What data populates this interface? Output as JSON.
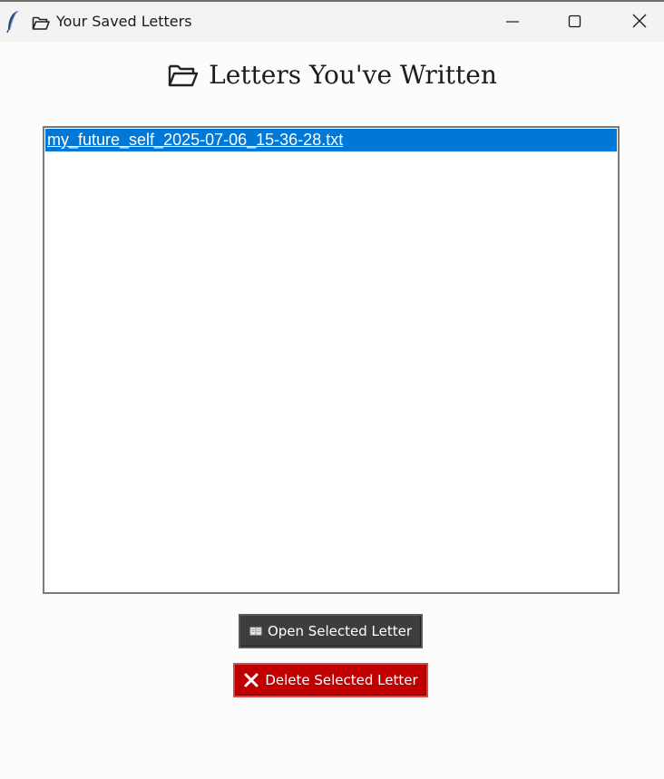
{
  "window": {
    "title": "Your Saved Letters",
    "app_icon": "feather-icon",
    "title_icon": "folder-icon",
    "controls": {
      "minimize": "minimize-icon",
      "maximize": "maximize-icon",
      "close": "close-icon"
    }
  },
  "heading": {
    "icon": "folder-icon",
    "text": "Letters You've Written"
  },
  "letters": {
    "items": [
      {
        "name": "my_future_self_2025-07-06_15-36-28.txt",
        "selected": true
      }
    ]
  },
  "buttons": {
    "open": {
      "label": "Open Selected Letter",
      "icon": "book-icon",
      "color": "#3d3d3d"
    },
    "delete": {
      "label": "Delete Selected Letter",
      "icon": "x-icon",
      "color": "#c00000"
    }
  },
  "colors": {
    "selection": "#0078d7",
    "titlebar": "#f3f3f3",
    "background": "#fcfcfc"
  }
}
